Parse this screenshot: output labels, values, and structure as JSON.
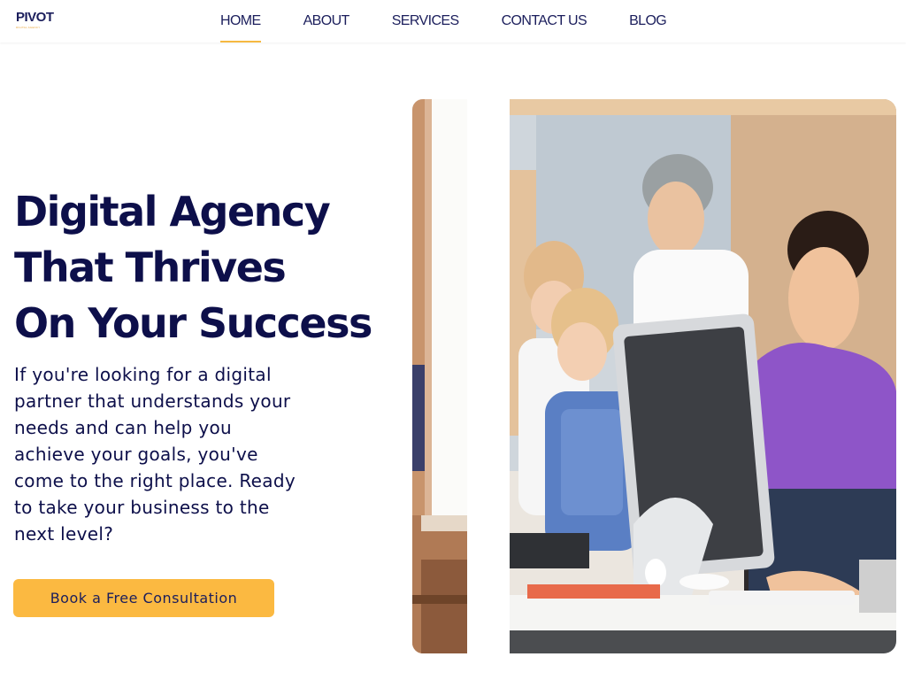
{
  "header": {
    "logo_text": "PIVOT",
    "logo_tagline": "DIGITAL AGENCY",
    "nav": [
      {
        "label": "HOME",
        "active": true
      },
      {
        "label": "ABOUT",
        "active": false
      },
      {
        "label": "SERVICES",
        "active": false
      },
      {
        "label": "CONTACT US",
        "active": false
      },
      {
        "label": "BLOG",
        "active": false
      }
    ]
  },
  "hero": {
    "title_lines": [
      "Digital Agency",
      "That Thrives",
      "On Your Success"
    ],
    "description": "If you're looking for a digital partner that understands your needs and can help you achieve your goals, you've come to the right place. Ready to take your business to the next level?",
    "cta_label": "Book a Free Consultation"
  },
  "colors": {
    "accent": "#fbb941",
    "text": "#0d0f4a"
  },
  "images": {
    "left_panel": "office-window-photo-icon",
    "right_panel": "office-team-computer-photo-icon"
  }
}
